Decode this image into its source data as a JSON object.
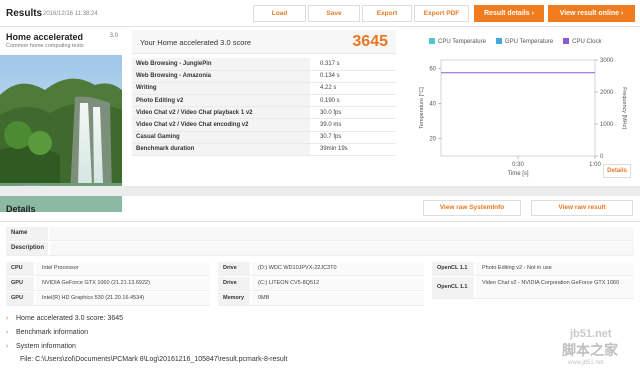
{
  "header": {
    "title": "Results",
    "timestamp": "2016/12/16 11:38:24",
    "buttons": {
      "load": "Load",
      "save": "Save",
      "export": "Export",
      "export_pdf": "Export PDF",
      "result_details": "Result details",
      "view_online": "View result online"
    },
    "accent": "#f07c1e"
  },
  "benchmark": {
    "name": "Home accelerated",
    "version": "3.0",
    "subtitle": "Common home computing tests"
  },
  "score": {
    "label": "Your Home accelerated 3.0 score",
    "value": "3645",
    "subscores": [
      {
        "name": "Web Browsing - JunglePin",
        "value": "0.317 s"
      },
      {
        "name": "Web Browsing - Amazonia",
        "value": "0.134 s"
      },
      {
        "name": "Writing",
        "value": "4.22 s"
      },
      {
        "name": "Photo Editing v2",
        "value": "0.190 s"
      },
      {
        "name": "Video Chat v2 / Video Chat playback 1 v2",
        "value": "30.0 fps"
      },
      {
        "name": "Video Chat v2 / Video Chat encoding v2",
        "value": "39.0 ms"
      },
      {
        "name": "Casual Gaming",
        "value": "30.7 fps"
      },
      {
        "name": "Benchmark duration",
        "value": "39min 19s"
      }
    ]
  },
  "chart_data": {
    "type": "line",
    "legend": [
      {
        "name": "CPU Temperature",
        "color": "#4dc9c9"
      },
      {
        "name": "GPU Temperature",
        "color": "#3fa9e0"
      },
      {
        "name": "CPU Clock",
        "color": "#8a5ad8"
      }
    ],
    "ylabel_left": "Temperature [°C]",
    "ylabel_right": "Frequency [MHz]",
    "xlabel": "Time [s]",
    "y_left_ticks": [
      "60",
      "40",
      "20"
    ],
    "y_right_ticks": [
      "3000",
      "2000",
      "1000",
      "0"
    ],
    "x_ticks": [
      "0:30",
      "1:00"
    ],
    "ylim_left": [
      10,
      65
    ],
    "ylim_right": [
      0,
      3000
    ],
    "series": [
      {
        "name": "CPU Clock",
        "axis": "right",
        "x": [
          0,
          1
        ],
        "y": [
          2600,
          2600
        ]
      }
    ],
    "details_label": "Details"
  },
  "details": {
    "title": "Details",
    "view_sysinfo": "View raw SystemInfo",
    "view_result": "View raw result",
    "name_label": "Name",
    "name_value": "",
    "desc_label": "Description",
    "desc_value": "",
    "hw_col1": [
      {
        "k": "CPU",
        "v": "Intel Processor"
      },
      {
        "k": "GPU",
        "v": "NVIDIA GeForce GTX 1060 (21.21.13.6922)"
      },
      {
        "k": "GPU",
        "v": "Intel(R) HD Graphics 530 (21.20.16.4534)"
      }
    ],
    "hw_col2": [
      {
        "k": "Drive",
        "v": "(D:) WDC WD10JPVX-22JC3T0"
      },
      {
        "k": "Drive",
        "v": "(C:) LITEON CV5-8Q512"
      },
      {
        "k": "Memory",
        "v": "0MB"
      }
    ],
    "hw_col3": [
      {
        "k": "OpenCL 1.1",
        "v": "Photo Editing v2 - Not in use"
      },
      {
        "k": "OpenCL 1.1",
        "v": "Video Chat v2 - NVIDIA Corporation GeForce GTX 1060"
      }
    ],
    "expandables": [
      "Home accelerated 3.0 score: 3645",
      "Benchmark information",
      "System information"
    ],
    "file": "File: C:\\Users\\zol\\Documents\\PCMark 8\\Log\\20161216_105847\\result.pcmark-8-result"
  },
  "watermark": {
    "line1": "jb51.net",
    "line2": "脚本之家",
    "line3": "www.jb51.net"
  }
}
